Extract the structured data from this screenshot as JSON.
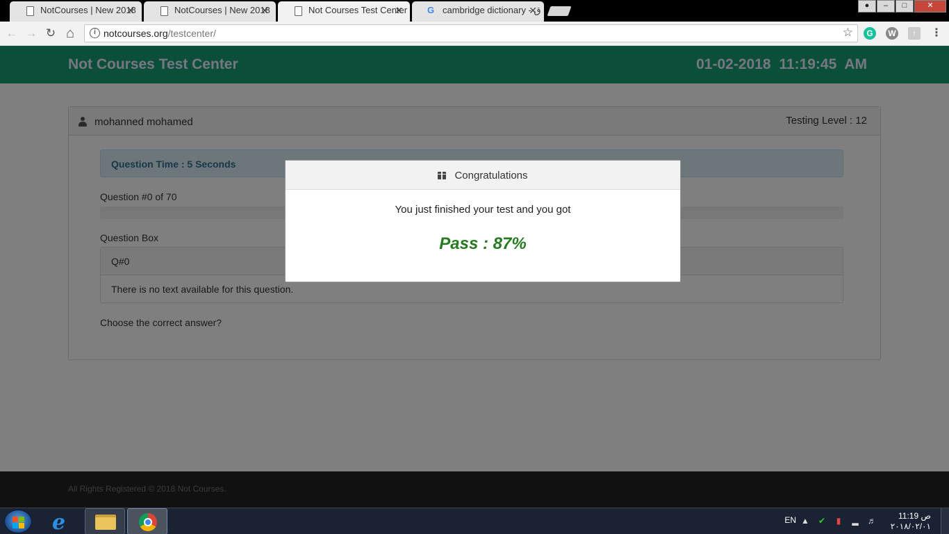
{
  "browser": {
    "tabs": [
      {
        "title": "NotCourses | New 2018",
        "active": false
      },
      {
        "title": "NotCourses | New 2018",
        "active": false
      },
      {
        "title": "Not Courses Test Center",
        "active": true
      },
      {
        "title": "cambridge dictionary - ق",
        "active": false
      }
    ],
    "close_glyph": "✕",
    "url_domain": "notcourses.org",
    "url_path": "/testcenter/",
    "nav": {
      "back": "←",
      "forward": "→",
      "reload": "↻",
      "home": "⌂"
    },
    "star": "☆",
    "extensions": {
      "grammarly": "G",
      "wordpress": "W",
      "pdf": "↑",
      "menu": "⋮"
    }
  },
  "page": {
    "brand": "Not Courses Test Center",
    "date": "01-02-2018",
    "time": "11:19:45 AM",
    "user_name": "mohanned mohamed",
    "testing_level": "Testing Level : 12",
    "question_time": "Question Time : 5 Seconds",
    "question_number": "Question #0 of 70",
    "progress_fraction": 0,
    "question_box_label": "Question Box",
    "question_id": "Q#0",
    "question_text": "There is no text available for this question.",
    "choose_prompt": "Choose the correct answer?",
    "footer": "All Rights Registered © 2018 Not Courses."
  },
  "modal": {
    "title": "Congratulations",
    "message": "You just finished your test and you got",
    "result": "Pass : 87%"
  },
  "taskbar": {
    "language": "EN",
    "clock_time": "ص 11:19",
    "clock_date": "٢٠١٨/٠٢/٠١"
  },
  "colors": {
    "header_green": "#169f77",
    "pass_green": "#267a1f",
    "info_blue": "#31708f"
  }
}
